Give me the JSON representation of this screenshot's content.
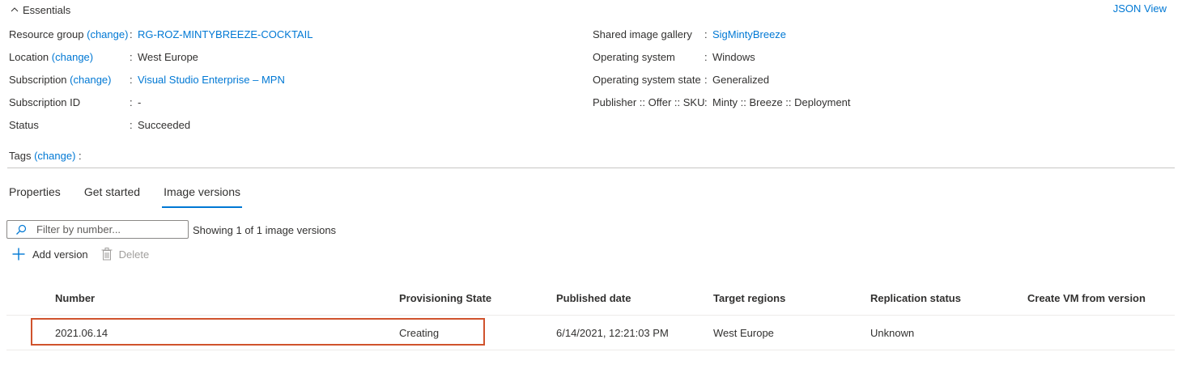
{
  "essentials": {
    "title": "Essentials",
    "json_view": "JSON View",
    "left": [
      {
        "label": "Resource group",
        "change": "(change)",
        "value": "RG-ROZ-MINTYBREEZE-COCKTAIL",
        "link": true
      },
      {
        "label": "Location",
        "change": "(change)",
        "value": "West Europe",
        "link": false
      },
      {
        "label": "Subscription",
        "change": "(change)",
        "value": "Visual Studio Enterprise – MPN",
        "link": true
      },
      {
        "label": "Subscription ID",
        "change": "",
        "value": "-",
        "link": false
      },
      {
        "label": "Status",
        "change": "",
        "value": "Succeeded",
        "link": false
      }
    ],
    "right": [
      {
        "label": "Shared image gallery",
        "value": "SigMintyBreeze",
        "link": true
      },
      {
        "label": "Operating system",
        "value": "Windows",
        "link": false
      },
      {
        "label": "Operating system state",
        "value": "Generalized",
        "link": false
      },
      {
        "label": "Publisher :: Offer :: SKU",
        "value": "Minty :: Breeze :: Deployment",
        "link": false
      }
    ],
    "tags": {
      "label": "Tags",
      "change": "(change)",
      "value": ""
    }
  },
  "tabs": [
    {
      "label": "Properties",
      "active": false
    },
    {
      "label": "Get started",
      "active": false
    },
    {
      "label": "Image versions",
      "active": true
    }
  ],
  "filter": {
    "placeholder": "Filter by number...",
    "showing": "Showing 1 of 1 image versions"
  },
  "toolbar": {
    "add": "Add version",
    "delete": "Delete"
  },
  "table": {
    "columns": [
      "Number",
      "Provisioning State",
      "Published date",
      "Target regions",
      "Replication status",
      "Create VM from version"
    ],
    "rows": [
      {
        "number": "2021.06.14",
        "state": "Creating",
        "published": "6/14/2021, 12:21:03 PM",
        "regions": "West Europe",
        "replication": "Unknown",
        "create_vm": ""
      }
    ]
  },
  "colors": {
    "accent": "#0078d4",
    "highlight": "#d0532d",
    "text": "#323130"
  }
}
